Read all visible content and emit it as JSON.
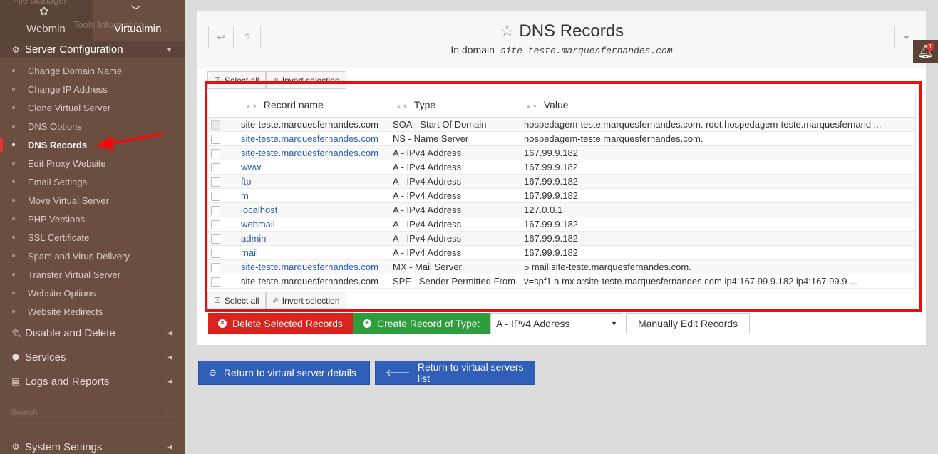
{
  "sidebar": {
    "switch": {
      "webmin_label": "Webmin",
      "virtualmin_label": "Virtualmin"
    },
    "ghost_text": {
      "top_left": "File Manager",
      "second": "Tools Information"
    },
    "server_config_label": "Server Configuration",
    "items": [
      {
        "label": "Change Domain Name"
      },
      {
        "label": "Change IP Address"
      },
      {
        "label": "Clone Virtual Server"
      },
      {
        "label": "DNS Options"
      },
      {
        "label": "DNS Records",
        "active": true
      },
      {
        "label": "Edit Proxy Website"
      },
      {
        "label": "Email Settings"
      },
      {
        "label": "Move Virtual Server"
      },
      {
        "label": "PHP Versions"
      },
      {
        "label": "SSL Certificate"
      },
      {
        "label": "Spam and Virus Delivery"
      },
      {
        "label": "Transfer Virtual Server"
      },
      {
        "label": "Website Options"
      },
      {
        "label": "Website Redirects"
      }
    ],
    "sections": {
      "disable_delete": "Disable and Delete",
      "services": "Services",
      "logs_reports": "Logs and Reports",
      "system_settings": "System Settings"
    },
    "search_placeholder": "Search"
  },
  "header": {
    "title": "DNS Records",
    "subtitle_prefix": "In domain",
    "domain": "site-teste.marquesfernandes.com"
  },
  "notification_count": "1",
  "selection": {
    "select_all": "Select all",
    "invert": "Invert selection"
  },
  "table": {
    "columns": [
      "Record name",
      "Type",
      "Value"
    ],
    "rows": [
      {
        "name": "site-teste.marquesfernandes.com",
        "type": "SOA - Start Of Domain",
        "value": "hospedagem-teste.marquesfernandes.com. root.hospedagem-teste.marquesfernand ...",
        "link": false,
        "disabled": true
      },
      {
        "name": "site-teste.marquesfernandes.com",
        "type": "NS - Name Server",
        "value": "hospedagem-teste.marquesfernandes.com.",
        "link": true
      },
      {
        "name": "site-teste.marquesfernandes.com",
        "type": "A - IPv4 Address",
        "value": "167.99.9.182",
        "link": true
      },
      {
        "name": "www",
        "type": "A - IPv4 Address",
        "value": "167.99.9.182",
        "link": true
      },
      {
        "name": "ftp",
        "type": "A - IPv4 Address",
        "value": "167.99.9.182",
        "link": true
      },
      {
        "name": "m",
        "type": "A - IPv4 Address",
        "value": "167.99.9.182",
        "link": true
      },
      {
        "name": "localhost",
        "type": "A - IPv4 Address",
        "value": "127.0.0.1",
        "link": true
      },
      {
        "name": "webmail",
        "type": "A - IPv4 Address",
        "value": "167.99.9.182",
        "link": true
      },
      {
        "name": "admin",
        "type": "A - IPv4 Address",
        "value": "167.99.9.182",
        "link": true
      },
      {
        "name": "mail",
        "type": "A - IPv4 Address",
        "value": "167.99.9.182",
        "link": true
      },
      {
        "name": "site-teste.marquesfernandes.com",
        "type": "MX - Mail Server",
        "value": "5 mail.site-teste.marquesfernandes.com.",
        "link": true
      },
      {
        "name": "site-teste.marquesfernandes.com",
        "type": "SPF - Sender Permitted From",
        "value": "v=spf1 a mx a:site-teste.marquesfernandes.com ip4:167.99.9.182 ip4:167.99.9 ...",
        "link": false
      }
    ]
  },
  "actions": {
    "delete": "Delete Selected Records",
    "create": "Create Record of Type:",
    "record_type": "A - IPv4 Address",
    "manual": "Manually Edit Records"
  },
  "nav": {
    "return_details": "Return to virtual server details",
    "return_list": "Return to virtual servers list"
  },
  "colors": {
    "sidebar_bg": "#6a4f41",
    "delete_red": "#d9231c",
    "create_green": "#2e9e3c",
    "nav_blue": "#2f5fb8",
    "highlight_red": "#e8100e",
    "link_blue": "#2a5db0"
  }
}
